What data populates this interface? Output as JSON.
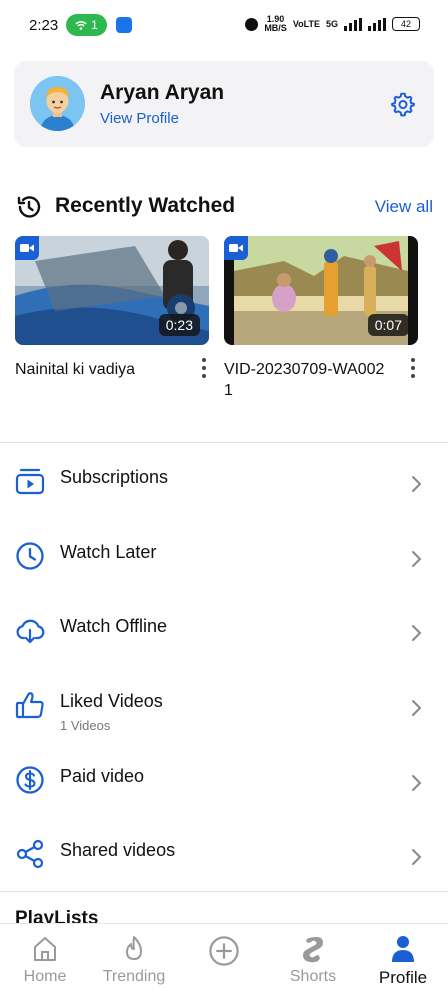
{
  "status_bar": {
    "time": "2:23",
    "hotspot_count": "1",
    "speed": "1.90",
    "speed_unit": "MB/S",
    "volte": "VoLTE",
    "network": "5G",
    "battery": "42"
  },
  "profile": {
    "name": "Aryan Aryan",
    "link_label": "View Profile"
  },
  "recently_watched": {
    "title": "Recently Watched",
    "view_all": "View all",
    "videos": [
      {
        "title": "Nainital ki vadiya",
        "duration": "0:23"
      },
      {
        "title": "VID-20230709-WA0021",
        "duration": "0:07"
      }
    ]
  },
  "menu": {
    "items": [
      {
        "label": "Subscriptions",
        "icon": "subscriptions-icon"
      },
      {
        "label": "Watch Later",
        "icon": "clock-icon"
      },
      {
        "label": "Watch Offline",
        "icon": "cloud-download-icon"
      },
      {
        "label": "Liked Videos",
        "sub": "1 Videos",
        "icon": "thumbs-up-icon"
      },
      {
        "label": "Paid video",
        "icon": "dollar-icon"
      },
      {
        "label": "Shared videos",
        "icon": "share-icon"
      }
    ]
  },
  "playlists_title": "PlayLists",
  "bottom_nav": {
    "items": [
      {
        "label": "Home",
        "icon": "home-icon"
      },
      {
        "label": "Trending",
        "icon": "flame-icon"
      },
      {
        "label": "",
        "icon": "plus-circle-icon"
      },
      {
        "label": "Shorts",
        "icon": "shorts-icon"
      },
      {
        "label": "Profile",
        "icon": "person-icon"
      }
    ],
    "active": "Profile"
  },
  "colors": {
    "accent": "#1a5fd4",
    "card_bg": "#f3f3f5",
    "hotspot": "#2fb84f",
    "inactive_nav": "#9a9a9a"
  }
}
